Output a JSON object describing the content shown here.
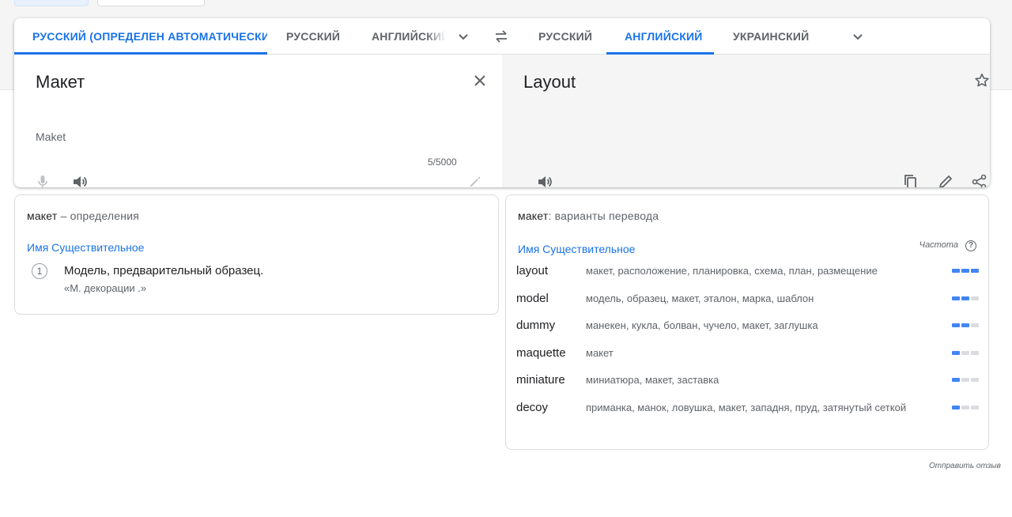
{
  "source_tabs": {
    "detect": "РУССКИЙ (ОПРЕДЕЛЕН АВТОМАТИЧЕСКИ)",
    "lang1": "РУССКИЙ",
    "lang2": "АНГЛИЙСКИЙ"
  },
  "target_tabs": {
    "lang1": "РУССКИЙ",
    "lang2": "АНГЛИЙСКИЙ",
    "lang3": "УКРАИНСКИЙ"
  },
  "source": {
    "text": "Макет",
    "transliteration": "Maket",
    "char_count": "5/5000"
  },
  "target": {
    "text": "Layout"
  },
  "definitions": {
    "word": "макет",
    "heading_suffix": " – определения",
    "part_of_speech": "Имя Существительное",
    "items": [
      {
        "number": "1",
        "text": "Модель, предварительный образец.",
        "example": "«М. декорации .»"
      }
    ]
  },
  "translations": {
    "word": "макет",
    "heading_suffix": ": варианты перевода",
    "part_of_speech": "Имя Существительное",
    "frequency_label": "Частота",
    "rows": [
      {
        "word": "layout",
        "synonyms": "макет, расположение, планировка, схема, план, размещение",
        "frequency": 3
      },
      {
        "word": "model",
        "synonyms": "модель, образец, макет, эталон, марка, шаблон",
        "frequency": 2
      },
      {
        "word": "dummy",
        "synonyms": "манекен, кукла, болван, чучело, макет, заглушка",
        "frequency": 2
      },
      {
        "word": "maquette",
        "synonyms": "макет",
        "frequency": 1
      },
      {
        "word": "miniature",
        "synonyms": "миниатюра, макет, заставка",
        "frequency": 1
      },
      {
        "word": "decoy",
        "synonyms": "приманка, манок, ловушка, макет, западня, пруд, затянутый сеткой",
        "frequency": 1
      }
    ]
  },
  "feedback_link": "Отправить отзыв",
  "colors": {
    "accent": "#1a73e8",
    "bar_on": "#4285f4",
    "bar_off": "#dadce0",
    "target_bg": "#f5f5f5"
  },
  "icons": [
    "chevron-down-icon",
    "swap-icon",
    "close-icon",
    "star-icon",
    "mic-icon",
    "speaker-icon",
    "pencil-icon",
    "copy-icon",
    "share-icon",
    "help-icon"
  ]
}
